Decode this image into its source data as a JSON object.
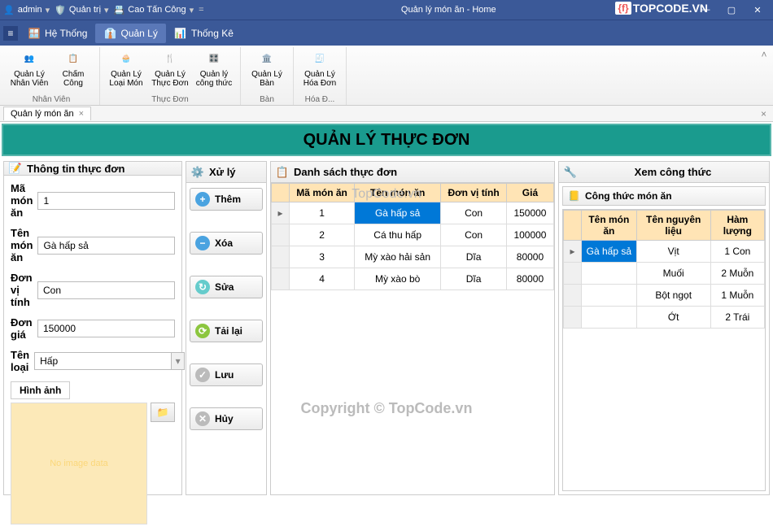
{
  "titlebar": {
    "user_icon": "👤",
    "user": "admin",
    "role_icon": "🛡️",
    "role": "Quản trị",
    "name_icon": "📇",
    "name": "Cao Tấn Công",
    "app_title": "Quản lý món ăn - Home",
    "brand": "TOPCODE.VN"
  },
  "menubar": {
    "items": [
      {
        "label": "Hệ Thống",
        "icon": "🪟",
        "active": false
      },
      {
        "label": "Quản Lý",
        "icon": "👔",
        "active": true
      },
      {
        "label": "Thống Kê",
        "icon": "📊",
        "active": false
      }
    ]
  },
  "ribbon": {
    "groups": [
      {
        "label": "Nhân Viên",
        "buttons": [
          {
            "label": "Quản Lý Nhân Viên",
            "icon": "👥"
          },
          {
            "label": "Chấm Công",
            "icon": "📋"
          }
        ]
      },
      {
        "label": "Thực Đơn",
        "buttons": [
          {
            "label": "Quản Lý Loại Món",
            "icon": "🧁"
          },
          {
            "label": "Quản Lý Thực Đơn",
            "icon": "🍴"
          },
          {
            "label": "Quản lý công thức",
            "icon": "🎛️"
          }
        ]
      },
      {
        "label": "Bàn",
        "buttons": [
          {
            "label": "Quản Lý Bàn",
            "icon": "🏛️"
          }
        ]
      },
      {
        "label": "Hóa Đ...",
        "buttons": [
          {
            "label": "Quản Lý Hóa Đơn",
            "icon": "🧾"
          }
        ]
      }
    ]
  },
  "doctab": {
    "label": "Quản lý món ăn"
  },
  "page_title": "QUẢN LÝ THỰC ĐƠN",
  "form": {
    "title": "Thông tin thực đơn",
    "fields": {
      "ma_label": "Mã món ăn",
      "ma_value": "1",
      "ten_label": "Tên món ăn",
      "ten_value": "Gà hấp sả",
      "dvt_label": "Đơn vị tính",
      "dvt_value": "Con",
      "gia_label": "Đơn giá",
      "gia_value": "150000",
      "loai_label": "Tên loại",
      "loai_value": "Hấp",
      "img_label": "Hình ảnh",
      "img_placeholder": "No image data"
    }
  },
  "actions": {
    "title": "Xử lý",
    "buttons": [
      {
        "label": "Thêm",
        "bg": "#4aa3e0",
        "sym": "+"
      },
      {
        "label": "Xóa",
        "bg": "#4aa3e0",
        "sym": "−"
      },
      {
        "label": "Sửa",
        "bg": "#6cc",
        "sym": "↻"
      },
      {
        "label": "Tải lại",
        "bg": "#8cc63f",
        "sym": "⟳"
      },
      {
        "label": "Lưu",
        "bg": "#bbb",
        "sym": "✓"
      },
      {
        "label": "Hủy",
        "bg": "#bbb",
        "sym": "✕"
      }
    ]
  },
  "list": {
    "title": "Danh sách thực đơn",
    "cols": [
      "Mã món ăn",
      "Tên món ăn",
      "Đơn vị tính",
      "Giá"
    ],
    "rows": [
      {
        "ma": "1",
        "ten": "Gà hấp sả",
        "dvt": "Con",
        "gia": "150000",
        "sel": true
      },
      {
        "ma": "2",
        "ten": "Cá thu hấp",
        "dvt": "Con",
        "gia": "100000"
      },
      {
        "ma": "3",
        "ten": "Mỳ xào hải sản",
        "dvt": "Dĩa",
        "gia": "80000"
      },
      {
        "ma": "4",
        "ten": "Mỳ xào bò",
        "dvt": "Dĩa",
        "gia": "80000"
      }
    ]
  },
  "recipe": {
    "title": "Xem công thức",
    "subtitle": "Công thức món ăn",
    "cols": [
      "Tên món ăn",
      "Tên nguyên liệu",
      "Hàm lượng"
    ],
    "rows": [
      {
        "ten": "Gà hấp sả",
        "nl": "Vịt",
        "hl": "1 Con",
        "sel": true
      },
      {
        "ten": "",
        "nl": "Muối",
        "hl": "2 Muỗn"
      },
      {
        "ten": "",
        "nl": "Bột ngọt",
        "hl": "1 Muỗn"
      },
      {
        "ten": "",
        "nl": "Ớt",
        "hl": "2 Trái"
      }
    ]
  },
  "watermark": {
    "center": "TopCode.vn",
    "bottom": "Copyright © TopCode.vn"
  }
}
